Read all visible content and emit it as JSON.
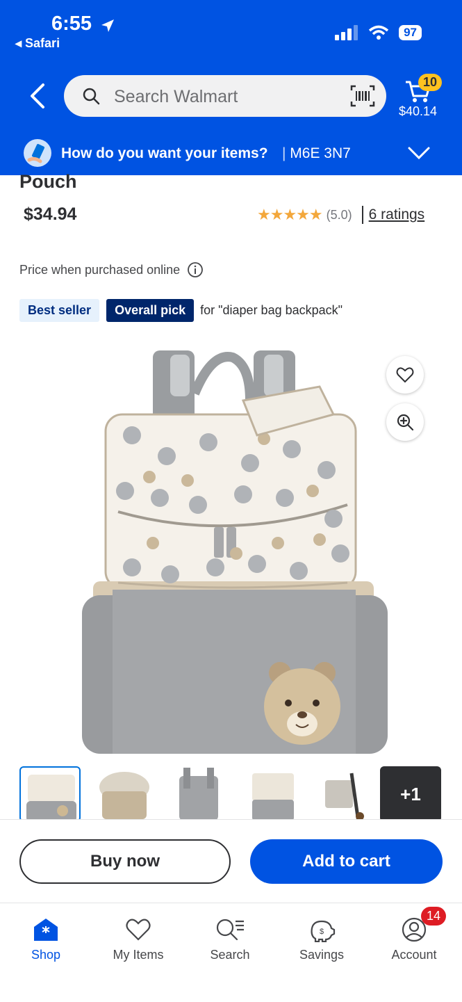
{
  "status_bar": {
    "time": "6:55",
    "back_app": "◂ Safari",
    "battery": "97"
  },
  "header": {
    "search_placeholder": "Search Walmart",
    "cart_count": "10",
    "cart_total": "$40.14",
    "delivery_question": "How do you want your items?",
    "delivery_separator": " | ",
    "delivery_zip": "M6E 3N7",
    "brand_color": "#0053e2"
  },
  "product": {
    "title_fragment": "Pouch",
    "price": "$34.94",
    "rating_stars": "★★★★★",
    "rating_score": "(5.0)",
    "rating_count": "6 ratings",
    "price_note": "Price when purchased online",
    "badge_best_seller": "Best seller",
    "badge_overall_pick": "Overall pick",
    "badge_for": "for \"diaper bag backpack\"",
    "thumb_more": "+1"
  },
  "actions": {
    "buy_now": "Buy now",
    "add_to_cart": "Add to cart"
  },
  "tabs": [
    {
      "label": "Shop",
      "icon": "shop-icon",
      "active": true
    },
    {
      "label": "My Items",
      "icon": "heart-icon"
    },
    {
      "label": "Search",
      "icon": "search-list-icon"
    },
    {
      "label": "Savings",
      "icon": "piggy-bank-icon"
    },
    {
      "label": "Account",
      "icon": "account-icon"
    }
  ],
  "account_badge": "14"
}
